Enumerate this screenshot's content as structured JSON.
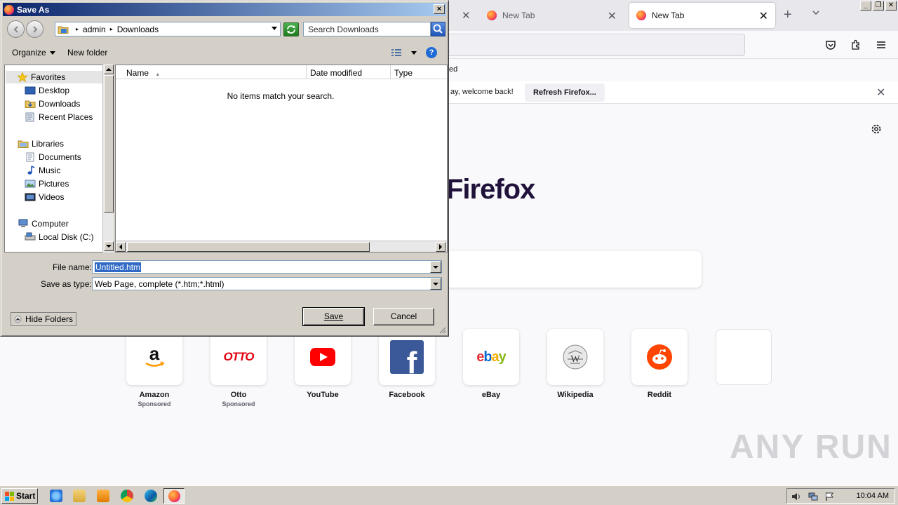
{
  "browser": {
    "tabs": [
      {
        "label": "New Tab"
      },
      {
        "label": "New Tab",
        "active": true
      }
    ],
    "bookmarks_fragment": "ed",
    "notice": {
      "text": "ay, welcome back!",
      "button": "Refresh Firefox..."
    },
    "wordmark": "Firefox",
    "shortcuts": [
      {
        "label": "Amazon",
        "sponsored": "Sponsored",
        "logo": "amazon-logo"
      },
      {
        "label": "Otto",
        "sponsored": "Sponsored",
        "logo_text": "OTTO"
      },
      {
        "label": "YouTube",
        "sponsored": "",
        "logo": "youtube-logo"
      },
      {
        "label": "Facebook",
        "sponsored": "",
        "logo": "facebook-logo"
      },
      {
        "label": "eBay",
        "sponsored": "",
        "logo_text": "ebay"
      },
      {
        "label": "Wikipedia",
        "sponsored": "",
        "logo": "wikipedia-logo"
      },
      {
        "label": "Reddit",
        "sponsored": "",
        "logo": "reddit-logo"
      },
      {
        "label": "",
        "sponsored": "",
        "logo": "empty-tile"
      }
    ],
    "watermark": "ANY RUN"
  },
  "dialog": {
    "title": "Save As",
    "close": "×",
    "address": {
      "segments": [
        "admin",
        "Downloads"
      ]
    },
    "search_placeholder": "Search Downloads",
    "toolbar": {
      "organize": "Organize",
      "new_folder": "New folder",
      "help": "?"
    },
    "nav": {
      "favorites": "Favorites",
      "desktop": "Desktop",
      "downloads": "Downloads",
      "recent": "Recent Places",
      "libraries": "Libraries",
      "documents": "Documents",
      "music": "Music",
      "pictures": "Pictures",
      "videos": "Videos",
      "computer": "Computer",
      "local_disk": "Local Disk (C:)"
    },
    "columns": {
      "name": "Name",
      "date": "Date modified",
      "type": "Type"
    },
    "empty_message": "No items match your search.",
    "file_name_label": "File name:",
    "file_name_value": "Untitled.htm",
    "save_type_label": "Save as type:",
    "save_type_value": "Web Page, complete (*.htm;*.html)",
    "hide_folders": "Hide Folders",
    "save": "Save",
    "cancel": "Cancel"
  },
  "taskbar": {
    "start": "Start",
    "clock": "10:04 AM"
  },
  "colors": {
    "title_bar": "#0a246a",
    "firefox_purple": "#20123a"
  }
}
